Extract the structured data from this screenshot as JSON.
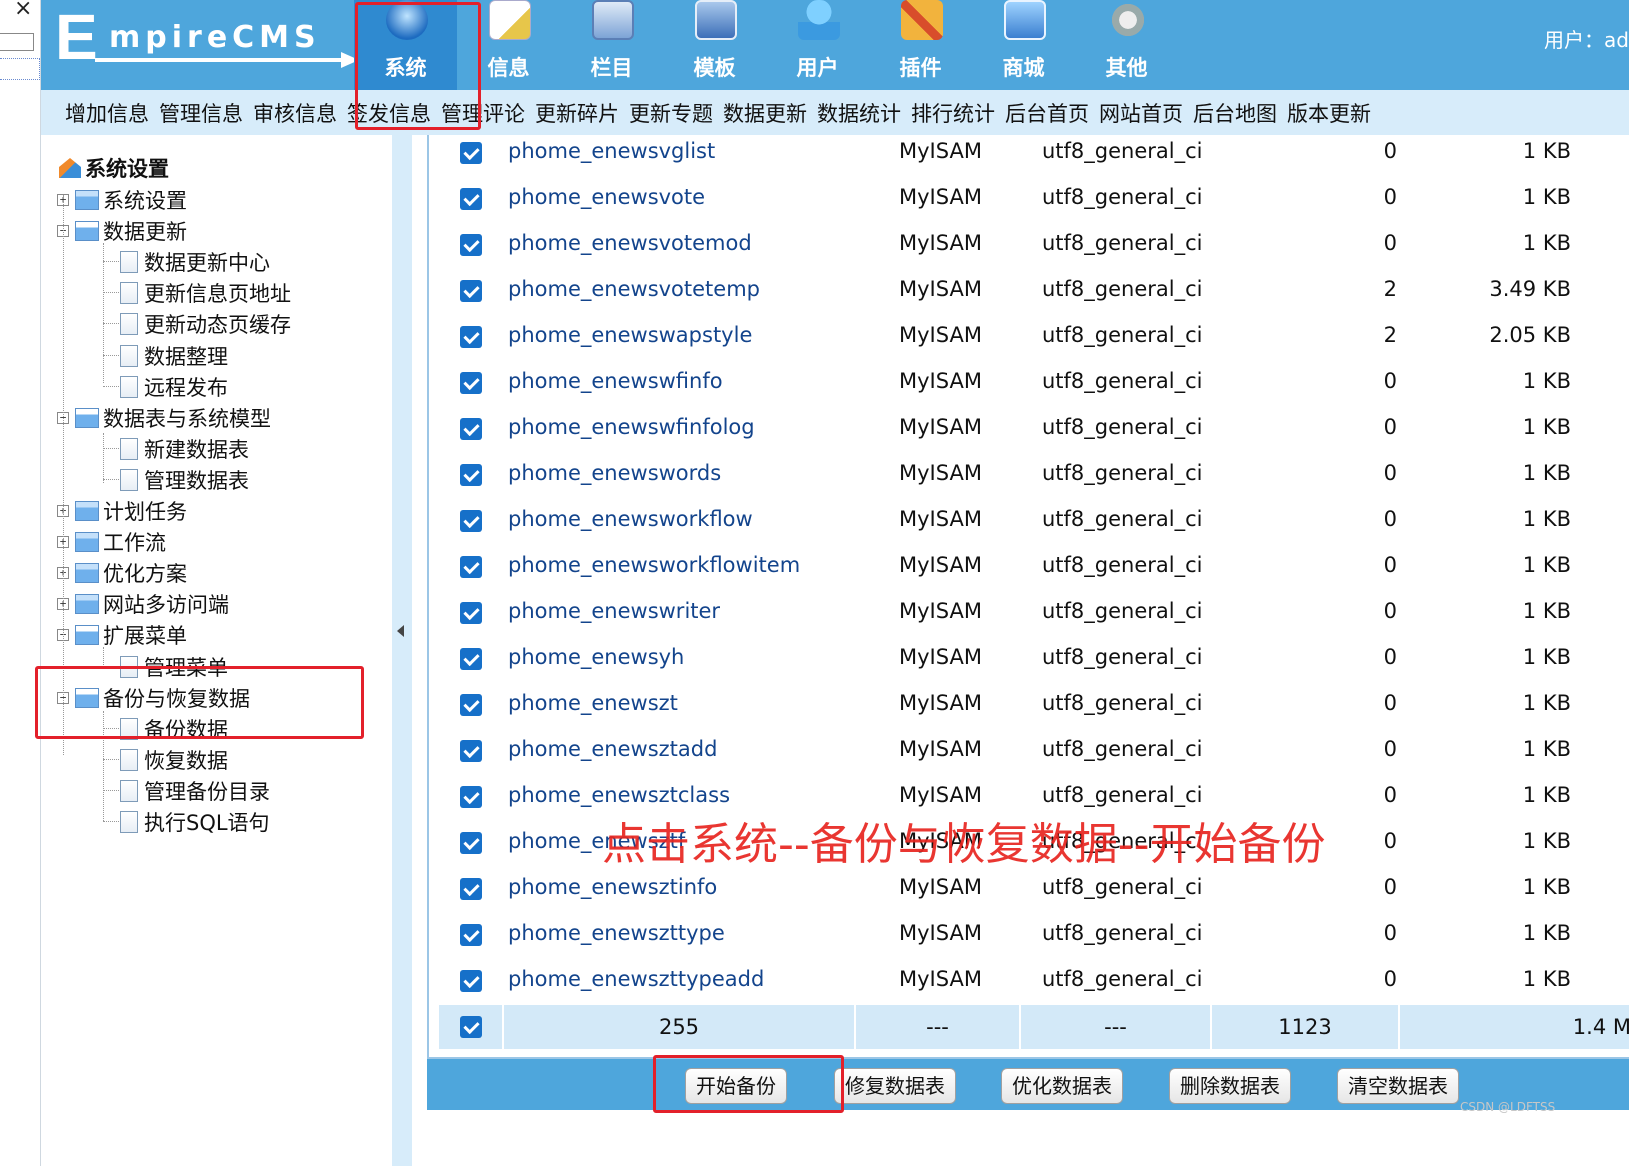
{
  "logo": {
    "first_letter": "E",
    "rest": "mpireCMS"
  },
  "nav": [
    {
      "label": "系统",
      "icon": "globe-icon",
      "active": true
    },
    {
      "label": "信息",
      "icon": "note-icon"
    },
    {
      "label": "栏目",
      "icon": "window-icon"
    },
    {
      "label": "模板",
      "icon": "template-icon"
    },
    {
      "label": "用户",
      "icon": "user-icon"
    },
    {
      "label": "插件",
      "icon": "plugin-icon"
    },
    {
      "label": "商城",
      "icon": "shop-icon"
    },
    {
      "label": "其他",
      "icon": "gear-icon"
    }
  ],
  "user_label": "用户：ad",
  "subnav": [
    "增加信息",
    "管理信息",
    "审核信息",
    "签发信息",
    "管理评论",
    "更新碎片",
    "更新专题",
    "数据更新",
    "数据统计",
    "排行统计",
    "后台首页",
    "网站首页",
    "后台地图",
    "版本更新"
  ],
  "sidebar": {
    "root": "系统设置",
    "items": [
      {
        "label": "系统设置",
        "level": 0,
        "type": "folder",
        "expanded": false
      },
      {
        "label": "数据更新",
        "level": 0,
        "type": "folder",
        "expanded": true
      },
      {
        "label": "数据更新中心",
        "level": 1,
        "type": "page"
      },
      {
        "label": "更新信息页地址",
        "level": 1,
        "type": "page"
      },
      {
        "label": "更新动态页缓存",
        "level": 1,
        "type": "page"
      },
      {
        "label": "数据整理",
        "level": 1,
        "type": "page"
      },
      {
        "label": "远程发布",
        "level": 1,
        "type": "page"
      },
      {
        "label": "数据表与系统模型",
        "level": 0,
        "type": "folder",
        "expanded": true
      },
      {
        "label": "新建数据表",
        "level": 1,
        "type": "page"
      },
      {
        "label": "管理数据表",
        "level": 1,
        "type": "page"
      },
      {
        "label": "计划任务",
        "level": 0,
        "type": "folder",
        "expanded": false
      },
      {
        "label": "工作流",
        "level": 0,
        "type": "folder",
        "expanded": false
      },
      {
        "label": "优化方案",
        "level": 0,
        "type": "folder",
        "expanded": false
      },
      {
        "label": "网站多访问端",
        "level": 0,
        "type": "folder",
        "expanded": false
      },
      {
        "label": "扩展菜单",
        "level": 0,
        "type": "folder",
        "expanded": true
      },
      {
        "label": "管理菜单",
        "level": 1,
        "type": "page"
      },
      {
        "label": "备份与恢复数据",
        "level": 0,
        "type": "folder",
        "expanded": true
      },
      {
        "label": "备份数据",
        "level": 1,
        "type": "page"
      },
      {
        "label": "恢复数据",
        "level": 1,
        "type": "page"
      },
      {
        "label": "管理备份目录",
        "level": 1,
        "type": "page"
      },
      {
        "label": "执行SQL语句",
        "level": 1,
        "type": "page"
      }
    ]
  },
  "tables": [
    {
      "name": "phome_enewsvglist",
      "engine": "MyISAM",
      "collation": "utf8_general_ci",
      "rows": "0",
      "size": "1 KB"
    },
    {
      "name": "phome_enewsvote",
      "engine": "MyISAM",
      "collation": "utf8_general_ci",
      "rows": "0",
      "size": "1 KB"
    },
    {
      "name": "phome_enewsvotemod",
      "engine": "MyISAM",
      "collation": "utf8_general_ci",
      "rows": "0",
      "size": "1 KB"
    },
    {
      "name": "phome_enewsvotetemp",
      "engine": "MyISAM",
      "collation": "utf8_general_ci",
      "rows": "2",
      "size": "3.49 KB"
    },
    {
      "name": "phome_enewswapstyle",
      "engine": "MyISAM",
      "collation": "utf8_general_ci",
      "rows": "2",
      "size": "2.05 KB"
    },
    {
      "name": "phome_enewswfinfo",
      "engine": "MyISAM",
      "collation": "utf8_general_ci",
      "rows": "0",
      "size": "1 KB"
    },
    {
      "name": "phome_enewswfinfolog",
      "engine": "MyISAM",
      "collation": "utf8_general_ci",
      "rows": "0",
      "size": "1 KB"
    },
    {
      "name": "phome_enewswords",
      "engine": "MyISAM",
      "collation": "utf8_general_ci",
      "rows": "0",
      "size": "1 KB"
    },
    {
      "name": "phome_enewsworkflow",
      "engine": "MyISAM",
      "collation": "utf8_general_ci",
      "rows": "0",
      "size": "1 KB"
    },
    {
      "name": "phome_enewsworkflowitem",
      "engine": "MyISAM",
      "collation": "utf8_general_ci",
      "rows": "0",
      "size": "1 KB"
    },
    {
      "name": "phome_enewswriter",
      "engine": "MyISAM",
      "collation": "utf8_general_ci",
      "rows": "0",
      "size": "1 KB"
    },
    {
      "name": "phome_enewsyh",
      "engine": "MyISAM",
      "collation": "utf8_general_ci",
      "rows": "0",
      "size": "1 KB"
    },
    {
      "name": "phome_enewszt",
      "engine": "MyISAM",
      "collation": "utf8_general_ci",
      "rows": "0",
      "size": "1 KB"
    },
    {
      "name": "phome_enewsztadd",
      "engine": "MyISAM",
      "collation": "utf8_general_ci",
      "rows": "0",
      "size": "1 KB"
    },
    {
      "name": "phome_enewsztclass",
      "engine": "MyISAM",
      "collation": "utf8_general_ci",
      "rows": "0",
      "size": "1 KB"
    },
    {
      "name": "phome_enewsztf",
      "engine": "MyISAM",
      "collation": "utf8_general_ci",
      "rows": "0",
      "size": "1 KB"
    },
    {
      "name": "phome_enewsztinfo",
      "engine": "MyISAM",
      "collation": "utf8_general_ci",
      "rows": "0",
      "size": "1 KB"
    },
    {
      "name": "phome_enewszttype",
      "engine": "MyISAM",
      "collation": "utf8_general_ci",
      "rows": "0",
      "size": "1 KB"
    },
    {
      "name": "phome_enewszttypeadd",
      "engine": "MyISAM",
      "collation": "utf8_general_ci",
      "rows": "0",
      "size": "1 KB"
    }
  ],
  "summary": {
    "count": "255",
    "engine": "---",
    "collation": "---",
    "rows": "1123",
    "size": "1.4 M"
  },
  "buttons": {
    "start_backup": "开始备份",
    "repair": "修复数据表",
    "optimize": "优化数据表",
    "delete": "删除数据表",
    "empty": "清空数据表"
  },
  "annotation": "点击系统--备份与恢复数据--开始备份",
  "watermark": "CSDN @LDFTSS",
  "colors": {
    "header": "#4ea6dc",
    "subnav": "#d7ecfa",
    "highlight": "#e3202a",
    "link": "#13448c"
  }
}
